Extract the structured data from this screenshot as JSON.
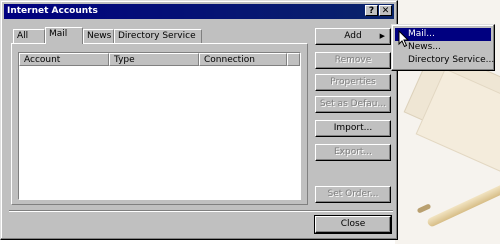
{
  "window": {
    "title": "Internet Accounts",
    "help_label": "?",
    "close_label": "✕"
  },
  "tabs": [
    {
      "label": "All",
      "active": false
    },
    {
      "label": "Mail",
      "active": true
    },
    {
      "label": "News",
      "active": false
    },
    {
      "label": "Directory Service",
      "active": false
    }
  ],
  "list": {
    "columns": [
      "Account",
      "Type",
      "Connection"
    ],
    "rows": []
  },
  "buttons": {
    "add": "Add",
    "remove": "Remove",
    "properties": "Properties",
    "set_default": "Set as Defau...",
    "import": "Import...",
    "export": "Export...",
    "set_order": "Set Order...",
    "close": "Close"
  },
  "add_menu": {
    "items": [
      "Mail...",
      "News...",
      "Directory Service..."
    ],
    "highlighted": "Mail..."
  },
  "colors": {
    "titlebar": "#000080",
    "dialog_face": "#c0c0c0",
    "menu_highlight": "#000080"
  },
  "icons": {
    "submenu_arrow": "triangle-right",
    "cursor": "arrow-pointer"
  }
}
